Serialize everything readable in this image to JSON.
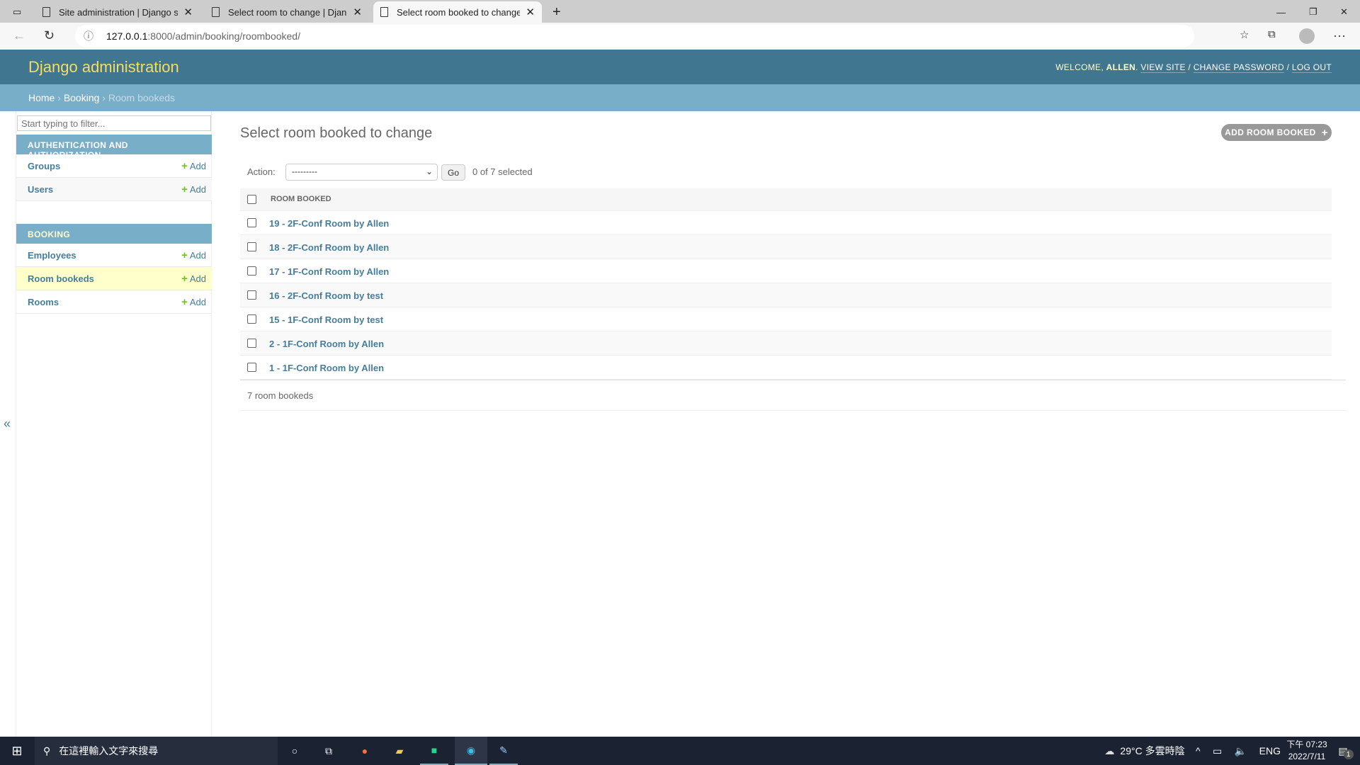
{
  "browser": {
    "tabs": [
      {
        "title": "Site administration | Django site"
      },
      {
        "title": "Select room to change | Django s"
      },
      {
        "title": "Select room booked to change |"
      }
    ],
    "url_host": "127.0.0.1",
    "url_rest": ":8000/admin/booking/roombooked/"
  },
  "header": {
    "brand": "Django administration",
    "welcome": "WELCOME,",
    "user": "ALLEN",
    "view_site": "VIEW SITE",
    "change_password": "CHANGE PASSWORD",
    "log_out": "LOG OUT"
  },
  "breadcrumbs": {
    "home": "Home",
    "app": "Booking",
    "current": "Room bookeds"
  },
  "sidebar": {
    "filter_placeholder": "Start typing to filter...",
    "auth_caption": "AUTHENTICATION AND AUTHORIZATION",
    "auth_items": [
      {
        "label": "Groups",
        "add": "Add"
      },
      {
        "label": "Users",
        "add": "Add"
      }
    ],
    "booking_caption": "BOOKING",
    "booking_items": [
      {
        "label": "Employees",
        "add": "Add"
      },
      {
        "label": "Room bookeds",
        "add": "Add"
      },
      {
        "label": "Rooms",
        "add": "Add"
      }
    ],
    "collapse": "«"
  },
  "main": {
    "title": "Select room booked to change",
    "add_button": "ADD ROOM BOOKED",
    "action_label": "Action:",
    "action_value": "---------",
    "go": "Go",
    "selected": "0 of 7 selected",
    "column": "ROOM BOOKED",
    "rows": [
      "19 - 2F-Conf Room by Allen",
      "18 - 2F-Conf Room by Allen",
      "17 - 1F-Conf Room by Allen",
      "16 - 2F-Conf Room by test",
      "15 - 1F-Conf Room by test",
      "2 - 1F-Conf Room by Allen",
      "1 - 1F-Conf Room by Allen"
    ],
    "count": "7 room bookeds"
  },
  "taskbar": {
    "search": "在這裡輸入文字來搜尋",
    "weather": "29°C  多雲時陰",
    "lang": "ENG",
    "time": "下午 07:23",
    "date": "2022/7/11",
    "notifications": "1"
  },
  "colors": {
    "header": "#417690",
    "breadcrumbs": "#79aec8",
    "brand": "#f5dd5d",
    "link": "#447e9b",
    "highlight": "#ffffcc"
  }
}
